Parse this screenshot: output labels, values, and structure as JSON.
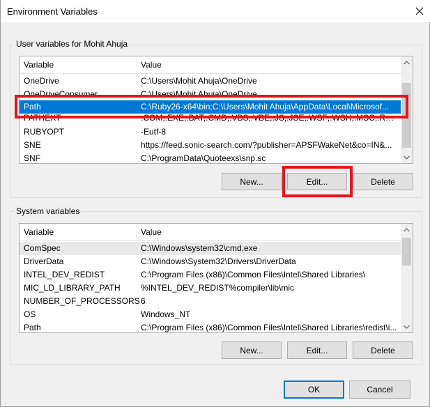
{
  "window": {
    "title": "Environment Variables"
  },
  "user_vars": {
    "label": "User variables for Mohit Ahuja",
    "header_variable": "Variable",
    "header_value": "Value",
    "rows": [
      {
        "name": "OneDrive",
        "value": "C:\\Users\\Mohit Ahuja\\OneDrive"
      },
      {
        "name": "OneDriveConsumer",
        "value": "C:\\Users\\Mohit Ahuja\\OneDrive"
      },
      {
        "name": "Path",
        "value": "C:\\Ruby26-x64\\bin;C:\\Users\\Mohit Ahuja\\AppData\\Local\\Microsof..."
      },
      {
        "name": "PATHEXT",
        "value": ".COM;.EXE;.BAT;.CMD;.VBS;.VBE;.JS;.JSE;.WSF;.WSH;.MSC;.RB;.RBW;..."
      },
      {
        "name": "RUBYOPT",
        "value": "-Eutf-8"
      },
      {
        "name": "SNE",
        "value": "https://feed.sonic-search.com/?publisher=APSFWakeNet&co=IN&..."
      },
      {
        "name": "SNF",
        "value": "C:\\ProgramData\\Quoteexs\\snp.sc"
      }
    ],
    "buttons": {
      "new": "New...",
      "edit": "Edit...",
      "delete": "Delete"
    }
  },
  "system_vars": {
    "label": "System variables",
    "header_variable": "Variable",
    "header_value": "Value",
    "rows": [
      {
        "name": "ComSpec",
        "value": "C:\\Windows\\system32\\cmd.exe"
      },
      {
        "name": "DriverData",
        "value": "C:\\Windows\\System32\\Drivers\\DriverData"
      },
      {
        "name": "INTEL_DEV_REDIST",
        "value": "C:\\Program Files (x86)\\Common Files\\Intel\\Shared Libraries\\"
      },
      {
        "name": "MIC_LD_LIBRARY_PATH",
        "value": "%INTEL_DEV_REDIST%compiler\\lib\\mic"
      },
      {
        "name": "NUMBER_OF_PROCESSORS",
        "value": "6"
      },
      {
        "name": "OS",
        "value": "Windows_NT"
      },
      {
        "name": "Path",
        "value": "C:\\Program Files (x86)\\Common Files\\Intel\\Shared Libraries\\redist\\i..."
      }
    ],
    "buttons": {
      "new": "New...",
      "edit": "Edit...",
      "delete": "Delete"
    }
  },
  "footer": {
    "ok": "OK",
    "cancel": "Cancel"
  },
  "colors": {
    "selection": "#0078d7",
    "annotation": "#e2171e"
  }
}
